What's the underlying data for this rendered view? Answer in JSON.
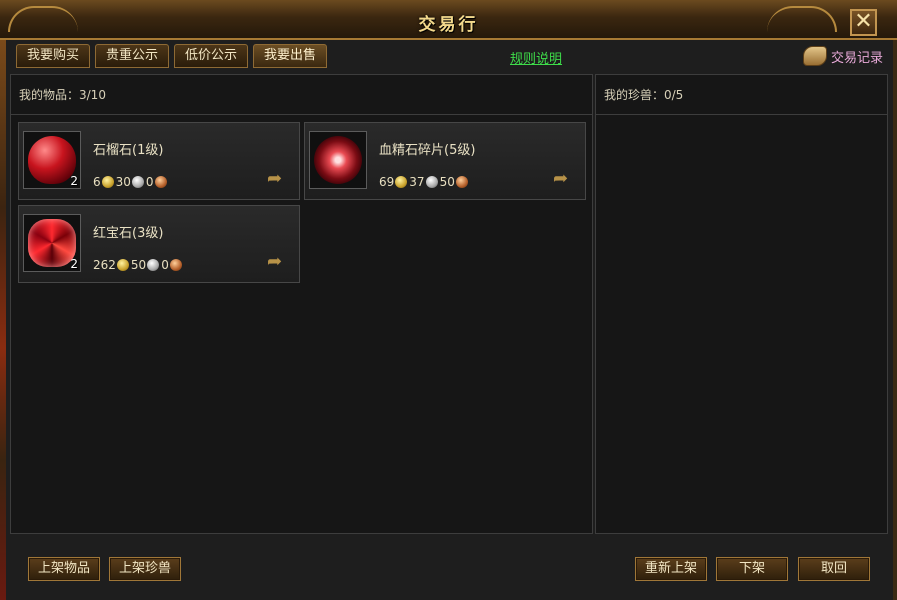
{
  "window": {
    "title": "交易行",
    "close_label": "✕"
  },
  "tabs": [
    {
      "label": "我要购买"
    },
    {
      "label": "贵重公示"
    },
    {
      "label": "低价公示"
    },
    {
      "label": "我要出售"
    }
  ],
  "rules_link": "规则说明",
  "trade_record": {
    "label": "交易记录",
    "icon": "scroll-icon"
  },
  "left_panel": {
    "header": "我的物品：3/10",
    "items": [
      {
        "name": "石榴石(1级)",
        "qty": "2",
        "gold": "6",
        "silver": "30",
        "copper": "0",
        "icon": "garnet-gem"
      },
      {
        "name": "血精石碎片(5级)",
        "qty": "",
        "gold": "69",
        "silver": "37",
        "copper": "50",
        "icon": "blood-essence-stone"
      },
      {
        "name": "红宝石(3级)",
        "qty": "2",
        "gold": "262",
        "silver": "50",
        "copper": "0",
        "icon": "ruby-gem"
      }
    ]
  },
  "right_panel": {
    "header": "我的珍兽：0/5"
  },
  "bottom_buttons": {
    "list_item": "上架物品",
    "list_pet": "上架珍兽",
    "relist": "重新上架",
    "delist": "下架",
    "cancel": "取回"
  },
  "colors": {
    "accent_gold": "#f3d98c",
    "link_green": "#3edc4a",
    "record_pink": "#e8a9d8"
  }
}
